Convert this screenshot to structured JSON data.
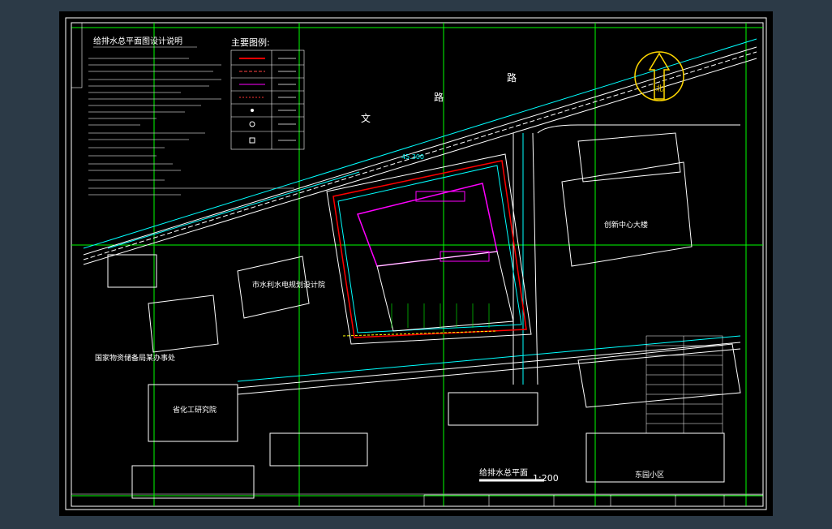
{
  "drawing": {
    "notes_title": "给排水总平面图设计说明",
    "legend_title": "主要图例:",
    "street_name_1": "文",
    "street_name_2": "路",
    "street_name_3": "路",
    "dimension_label": "45.300",
    "building_labels": {
      "east_large": "创新中心大楼",
      "west_building": "市水利水电规划设计院",
      "southwest_office": "国家物资储备局某办事处",
      "southwest_lab": "省化工研究院",
      "southeast_district": "东园小区"
    },
    "main_title": "给排水总平面",
    "scale": "1:200",
    "compass_label": "北"
  },
  "colors": {
    "background": "#000000",
    "frame": "#ffffff",
    "grid": "#00ff00",
    "accent_road": "#00ffff",
    "pipe_red": "#ff0000",
    "building_magenta": "#ff00ff",
    "compass": "#ffd700"
  }
}
